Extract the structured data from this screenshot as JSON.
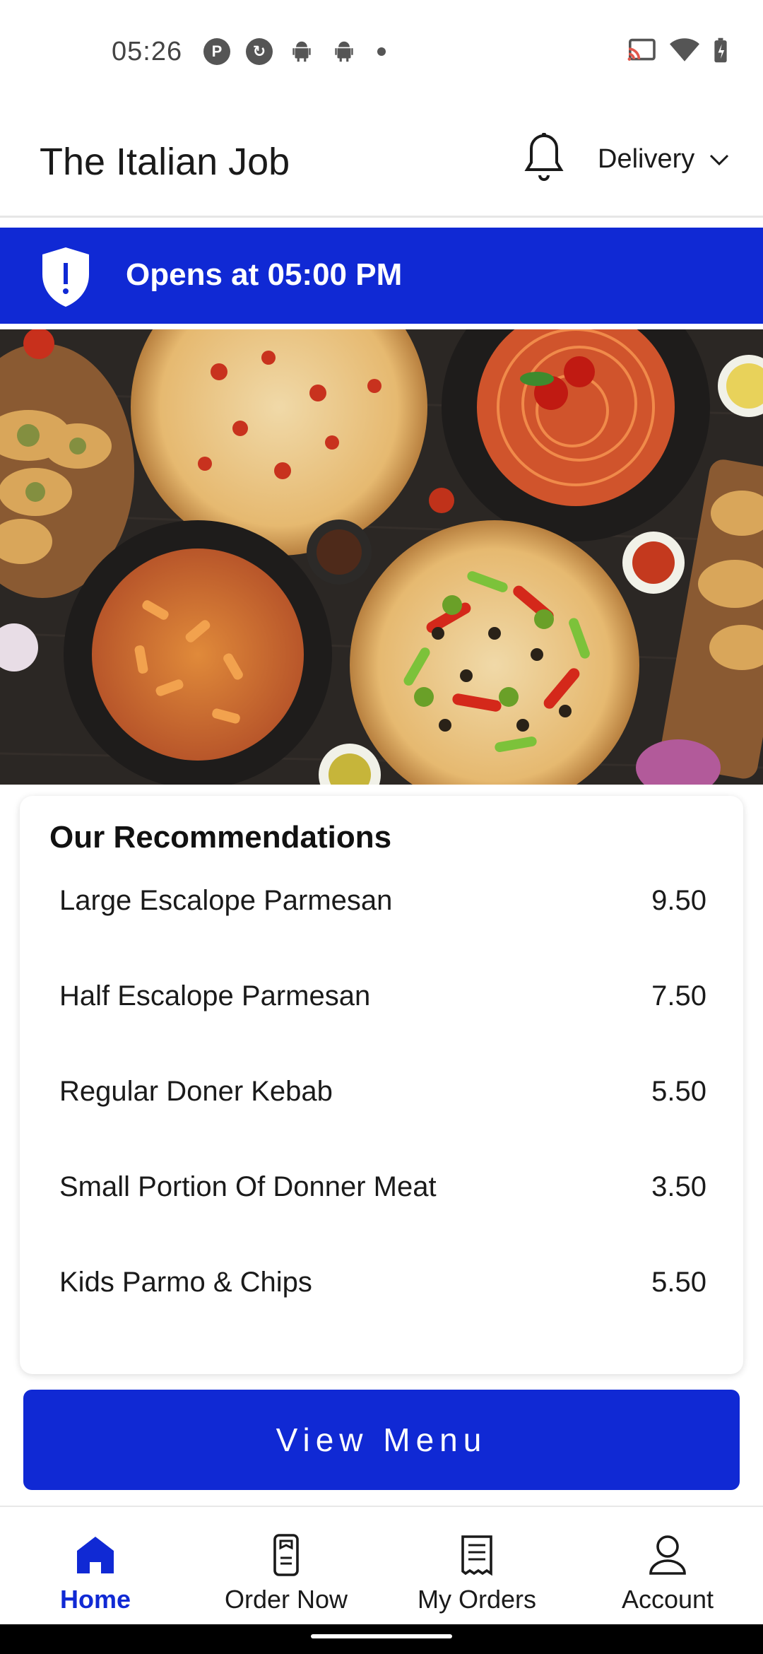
{
  "status_bar": {
    "time": "05:26",
    "left_icons": [
      "pocket-casts-icon",
      "sync-icon",
      "android-icon",
      "android-icon",
      "dot-icon"
    ],
    "right_icons": [
      "cast-icon",
      "wifi-icon",
      "battery-icon"
    ]
  },
  "header": {
    "title": "The Italian Job",
    "bell_icon": "bell-icon",
    "delivery_label": "Delivery",
    "dropdown_icon": "chevron-down-icon"
  },
  "banner": {
    "icon": "shield-alert-icon",
    "text": "Opens at 05:00 PM",
    "color": "#1029d4"
  },
  "hero": {
    "image": "italian-food-spread-image"
  },
  "recommendations": {
    "title": "Our Recommendations",
    "items": [
      {
        "name": "Large Escalope Parmesan",
        "price": "9.50"
      },
      {
        "name": "Half Escalope Parmesan",
        "price": "7.50"
      },
      {
        "name": "Regular Doner Kebab",
        "price": "5.50"
      },
      {
        "name": "Small Portion Of Donner Meat",
        "price": "3.50"
      },
      {
        "name": "Kids Parmo & Chips",
        "price": "5.50"
      }
    ]
  },
  "view_menu_label": "View Menu",
  "bottom_nav": {
    "items": [
      {
        "label": "Home",
        "icon": "home-icon",
        "active": true
      },
      {
        "label": "Order Now",
        "icon": "order-now-icon",
        "active": false
      },
      {
        "label": "My Orders",
        "icon": "receipt-icon",
        "active": false
      },
      {
        "label": "Account",
        "icon": "person-icon",
        "active": false
      }
    ]
  },
  "colors": {
    "accent": "#1029d4",
    "text": "#1a1a1a"
  }
}
